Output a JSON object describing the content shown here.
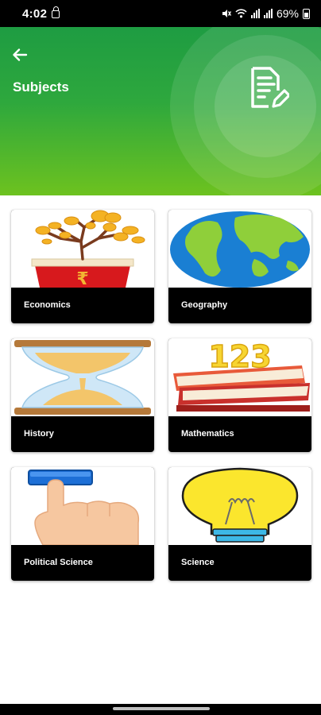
{
  "status_bar": {
    "time": "4:02",
    "battery": "69%",
    "icons": [
      "lock-icon",
      "mute-icon",
      "wifi-icon",
      "signal-icon",
      "battery-icon"
    ]
  },
  "header": {
    "title": "Subjects",
    "icons": [
      "back-arrow-icon",
      "edit-document-icon"
    ],
    "gradient": [
      "#1e9c42",
      "#6dc21f"
    ]
  },
  "subjects": [
    {
      "label": "Economics",
      "icon": "money-tree-icon"
    },
    {
      "label": "Geography",
      "icon": "globe-icon"
    },
    {
      "label": "History",
      "icon": "hourglass-icon"
    },
    {
      "label": "Mathematics",
      "icon": "numbers-books-icon"
    },
    {
      "label": "Political Science",
      "icon": "voting-hand-icon"
    },
    {
      "label": "Science",
      "icon": "light-bulb-icon"
    }
  ],
  "colors": {
    "card_label_bg": "#000000",
    "card_label_text": "#ffffff"
  }
}
